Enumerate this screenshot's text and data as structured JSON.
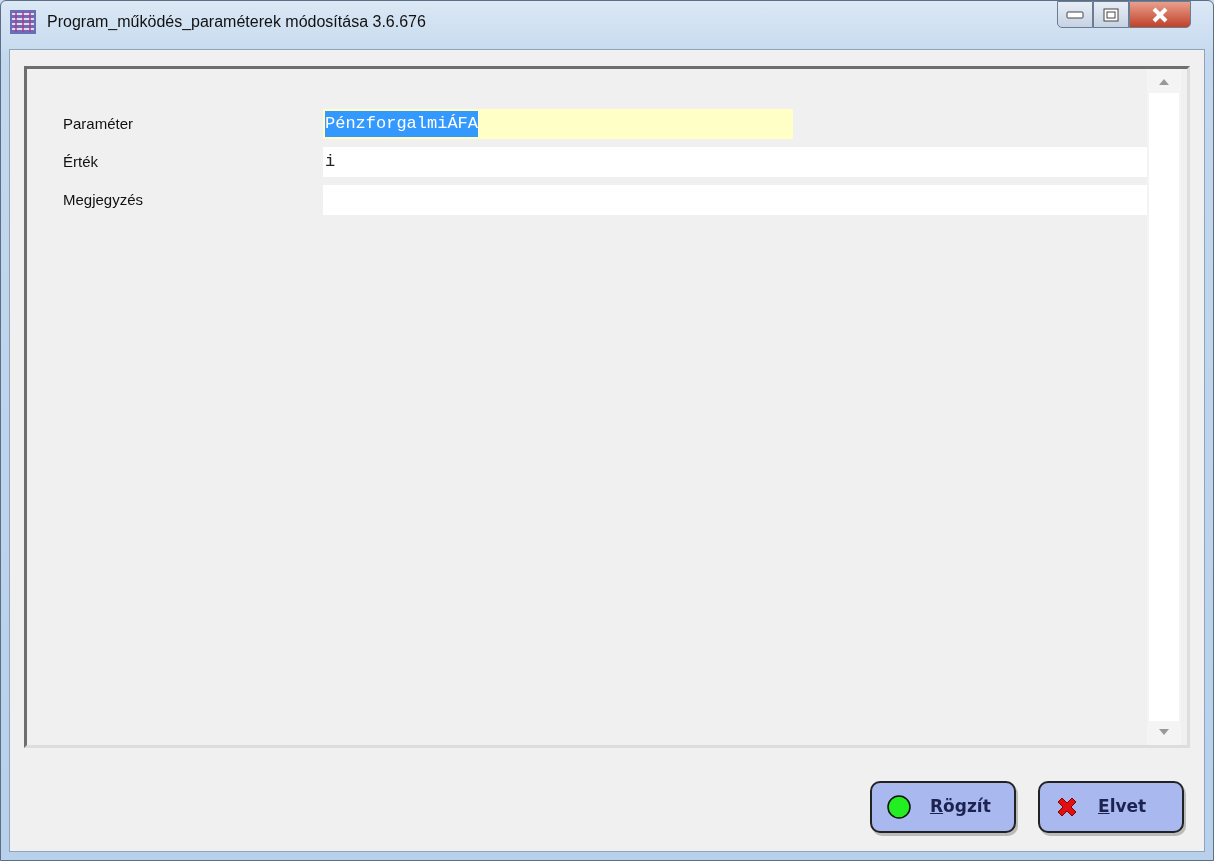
{
  "window": {
    "title": "Program_működés_paraméterek módosítása 3.6.676"
  },
  "fields": [
    {
      "label": "Paraméter",
      "value": "PénzforgalmiÁFA",
      "selected": true
    },
    {
      "label": "Érték",
      "value": "i",
      "selected": false
    },
    {
      "label": "Megjegyzés",
      "selected": false
    }
  ],
  "buttons": [
    {
      "label": "Rögzít",
      "kind": "ok"
    },
    {
      "label": "Elvet",
      "kind": "cancel"
    }
  ]
}
